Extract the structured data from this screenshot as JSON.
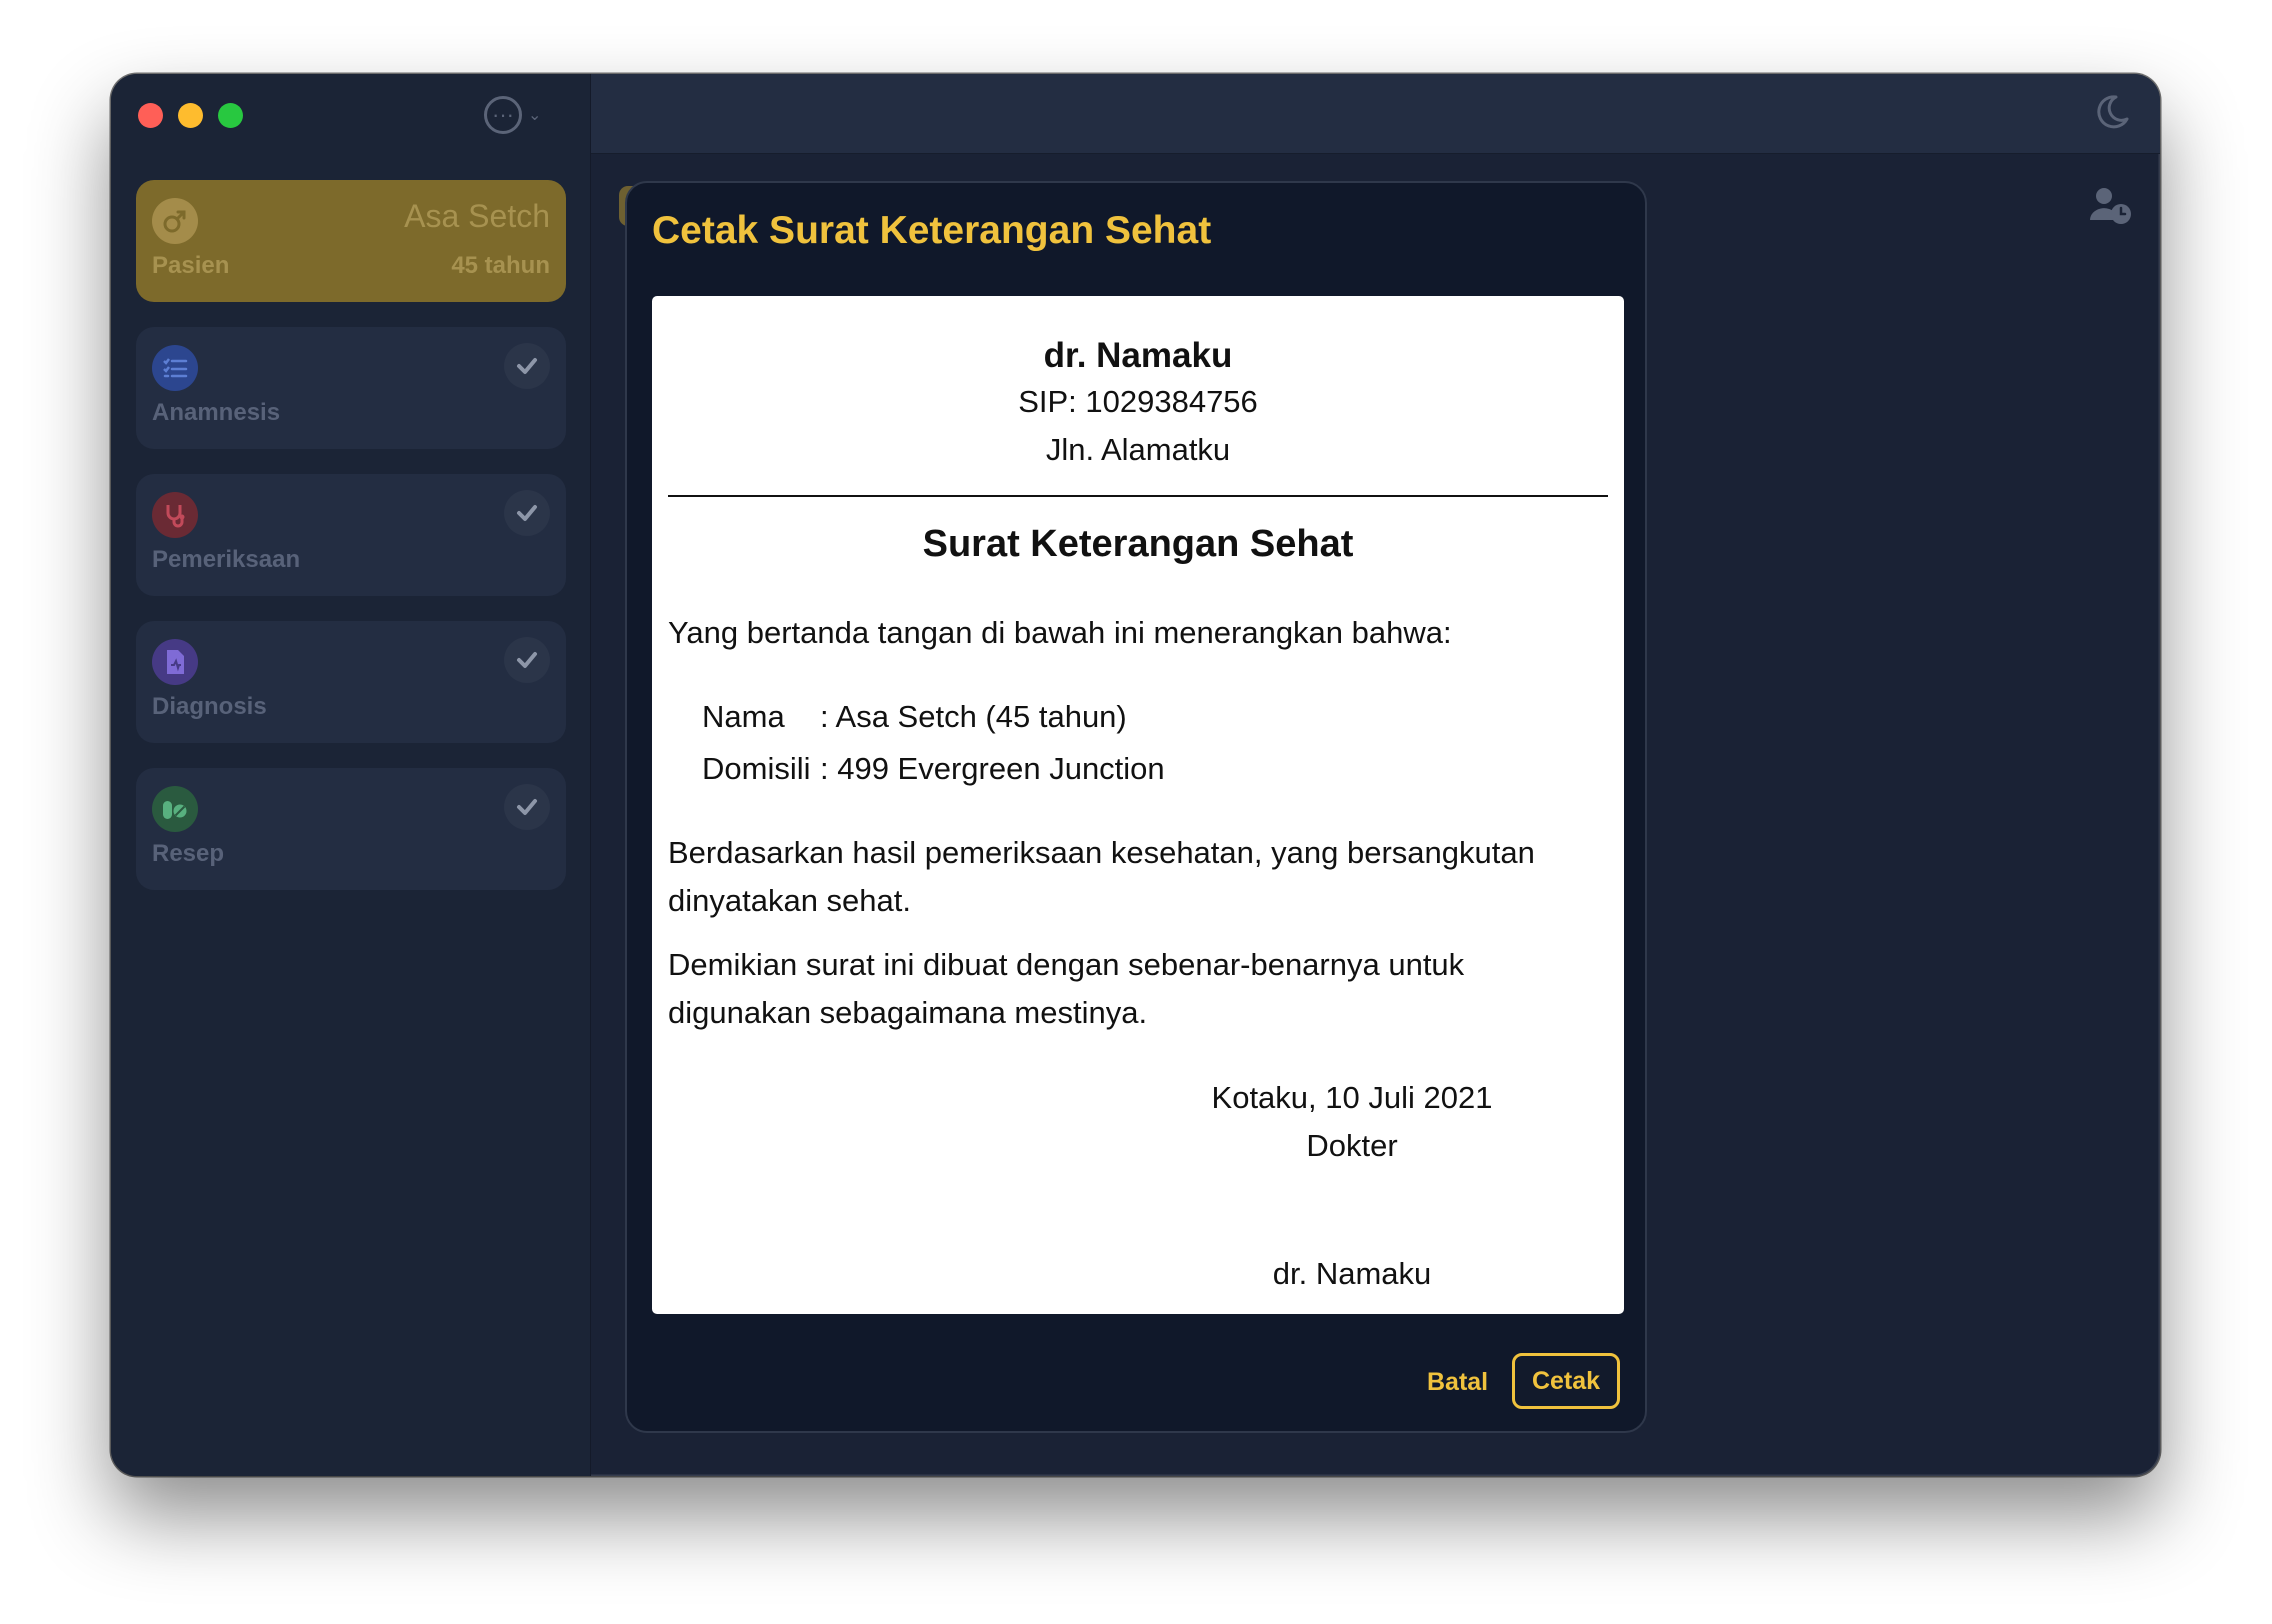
{
  "sidebar": {
    "more_glyph": "···",
    "more_chevron": "⌄",
    "patient": {
      "label": "Pasien",
      "name": "Asa Setch",
      "age": "45 tahun"
    },
    "items": [
      {
        "label": "Anamnesis",
        "icon": "checklist-icon",
        "color": "#3b5bdb"
      },
      {
        "label": "Pemeriksaan",
        "icon": "stethoscope-icon",
        "color": "#c0392b"
      },
      {
        "label": "Diagnosis",
        "icon": "medical-file-icon",
        "color": "#6c5ce7"
      },
      {
        "label": "Resep",
        "icon": "pills-icon",
        "color": "#2e8b57"
      }
    ]
  },
  "modal": {
    "title": "Cetak Surat Keterangan Sehat",
    "cancel_label": "Batal",
    "print_label": "Cetak"
  },
  "letter": {
    "doctor_name": "dr. Namaku",
    "sip": "SIP: 1029384756",
    "address": "Jln. Alamatku",
    "title": "Surat Keterangan Sehat",
    "intro": "Yang bertanda tangan di bawah ini menerangkan bahwa:",
    "field_name_key": "Nama",
    "field_name_value": ": Asa Setch (45 tahun)",
    "field_domicile_key": "Domisili",
    "field_domicile_value": ": 499 Evergreen Junction",
    "body1": "Berdasarkan hasil pemeriksaan kesehatan, yang bersangkutan dinyatakan sehat.",
    "body2": "Demikian surat ini dibuat dengan sebenar-benarnya untuk digunakan sebagaimana mestinya.",
    "place_date": "Kotaku, 10 Juli 2021",
    "role": "Dokter",
    "signature_name": "dr. Namaku"
  },
  "colors": {
    "accent": "#f0c23d",
    "background": "#1a2235",
    "modal": "#10182a"
  }
}
